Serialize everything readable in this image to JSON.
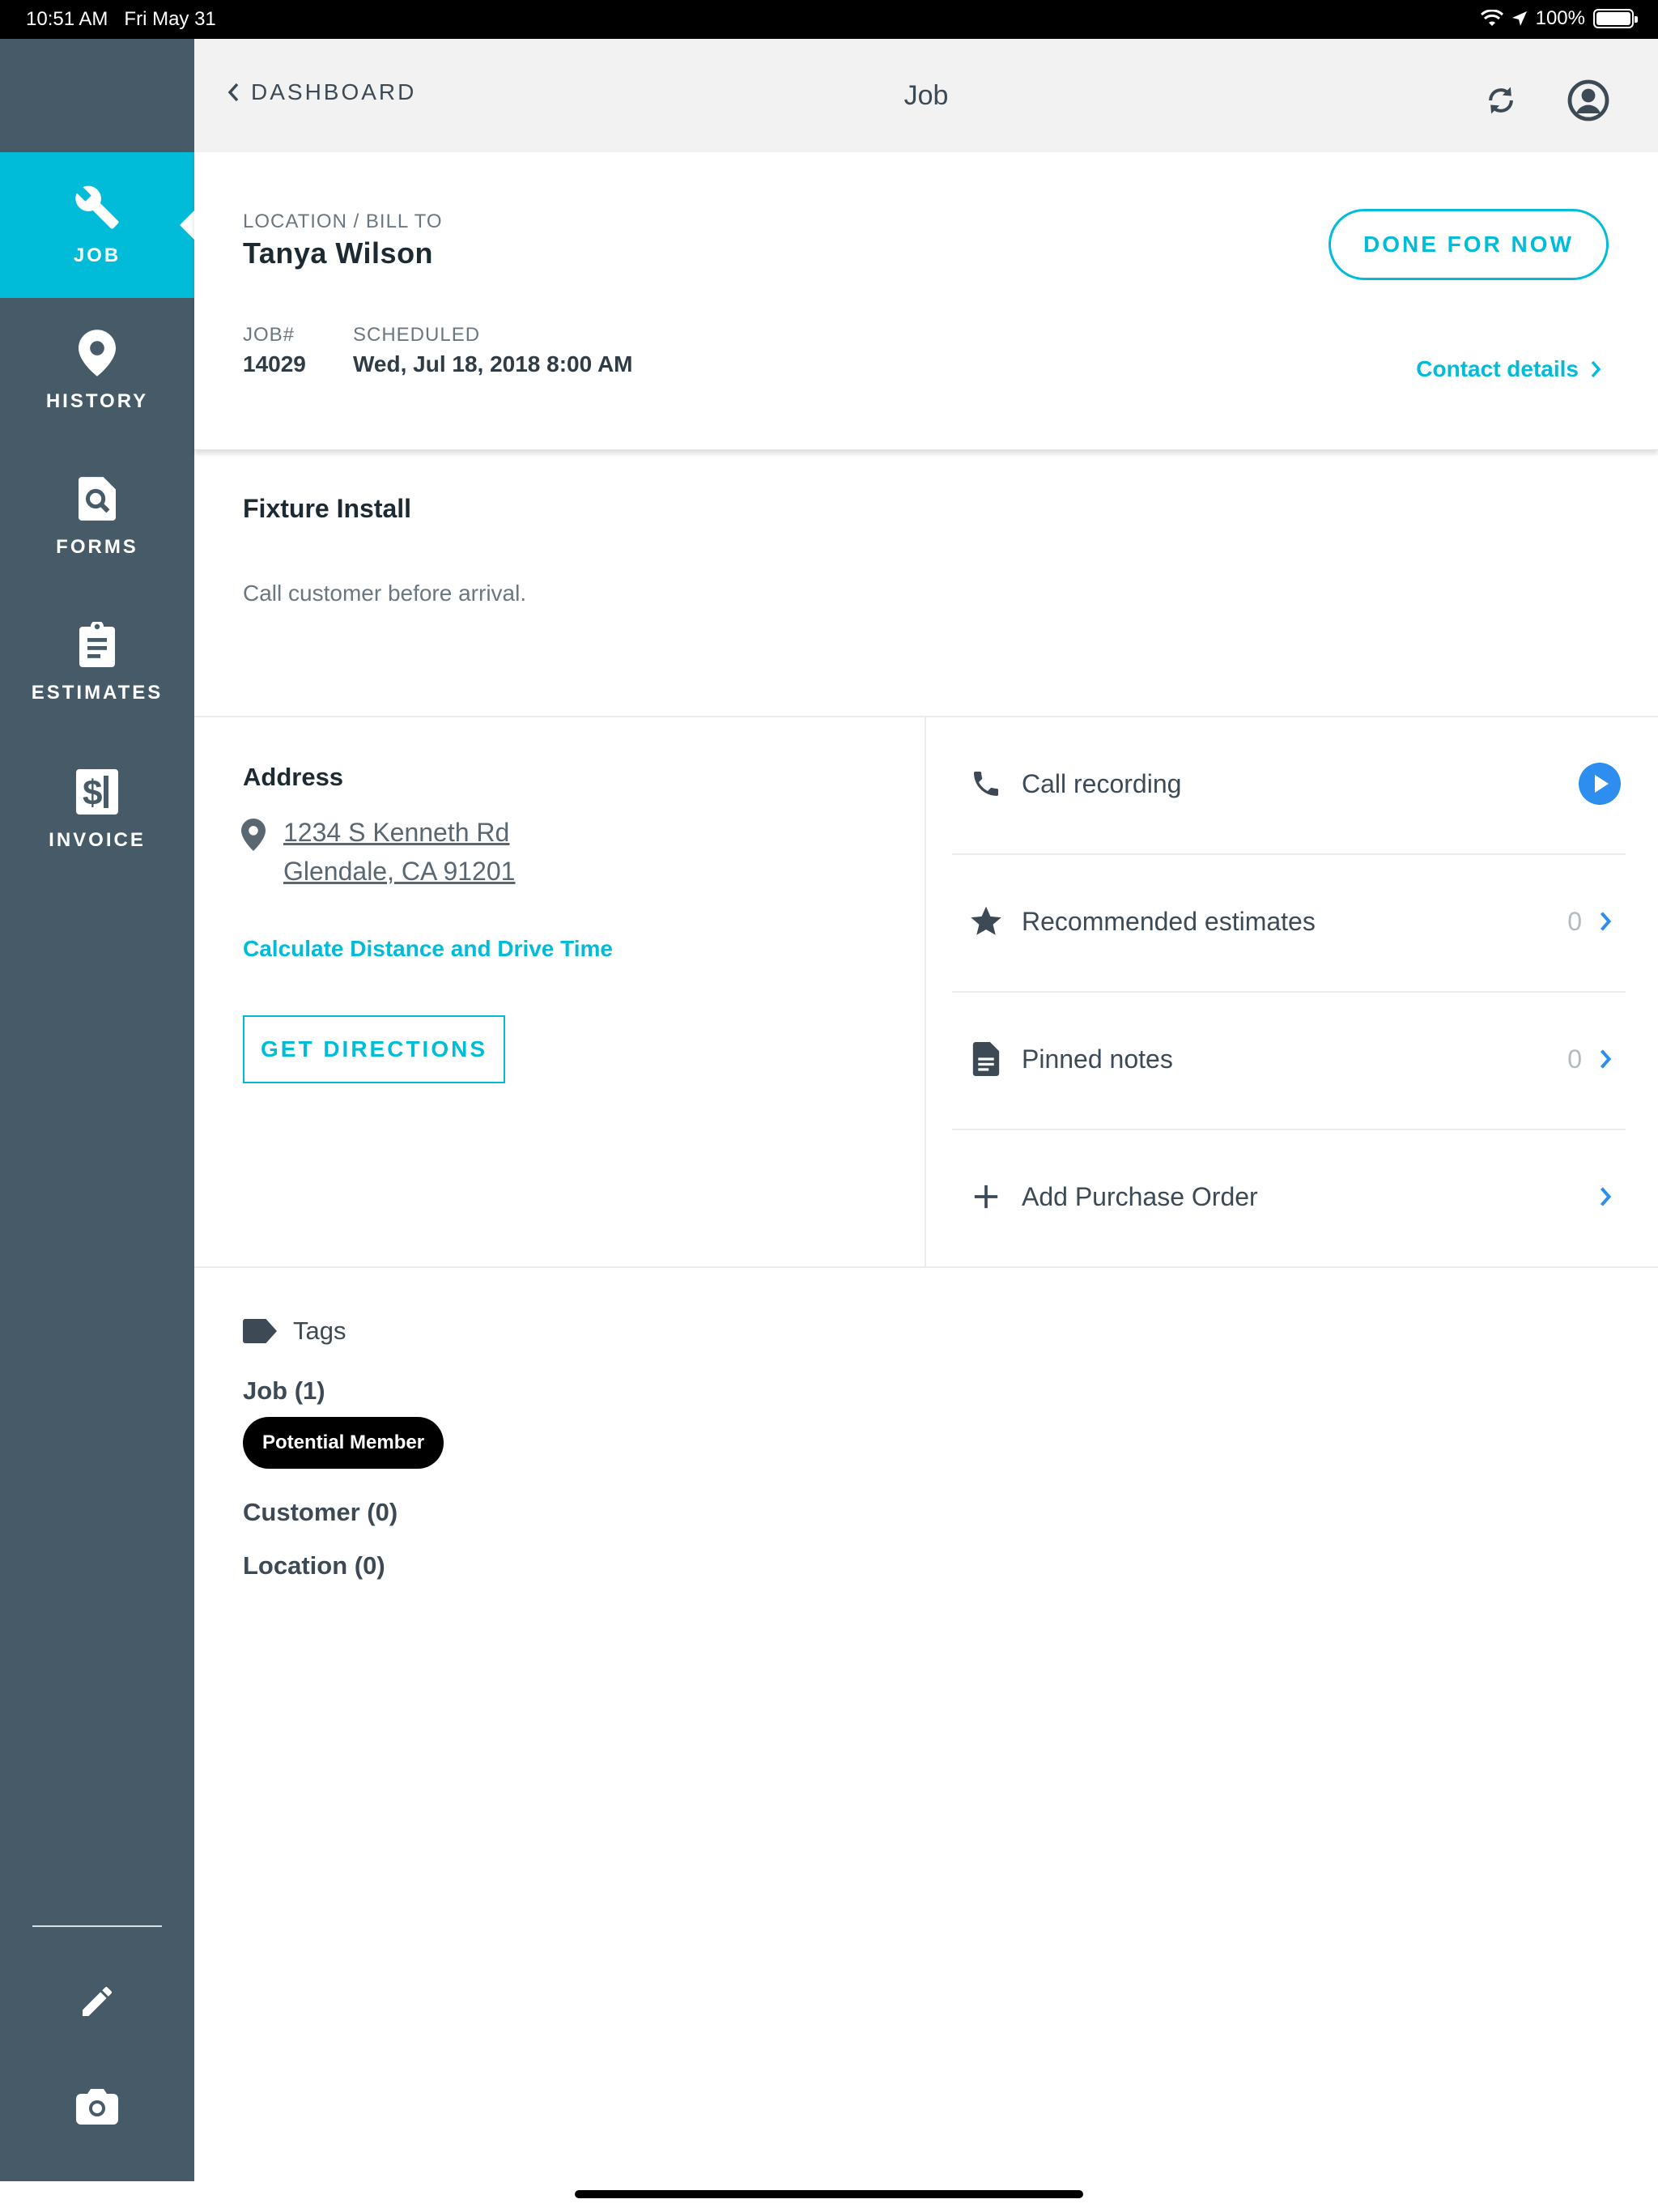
{
  "status_bar": {
    "time": "10:51 AM",
    "date": "Fri May 31",
    "battery": "100%"
  },
  "sidebar": {
    "items": [
      {
        "label": "JOB",
        "icon": "wrench-icon",
        "active": true
      },
      {
        "label": "HISTORY",
        "icon": "location-pin-icon",
        "active": false
      },
      {
        "label": "FORMS",
        "icon": "form-search-icon",
        "active": false
      },
      {
        "label": "ESTIMATES",
        "icon": "clipboard-icon",
        "active": false
      },
      {
        "label": "INVOICE",
        "icon": "invoice-dollar-icon",
        "active": false
      }
    ],
    "tools": [
      {
        "icon": "pencil-icon"
      },
      {
        "icon": "camera-icon"
      }
    ]
  },
  "header": {
    "back_label": "DASHBOARD",
    "title": "Job"
  },
  "job": {
    "location_label": "LOCATION / BILL TO",
    "customer_name": "Tanya Wilson",
    "done_label": "DONE FOR NOW",
    "job_number_label": "JOB#",
    "job_number": "14029",
    "scheduled_label": "SCHEDULED",
    "scheduled_value": "Wed, Jul 18, 2018 8:00 AM",
    "contact_label": "Contact details"
  },
  "description": {
    "title": "Fixture Install",
    "note": "Call customer before arrival."
  },
  "address": {
    "title": "Address",
    "line1": "1234 S Kenneth Rd",
    "line2": "Glendale, CA 91201",
    "calc_label": "Calculate Distance and Drive Time",
    "directions_label": "GET DIRECTIONS"
  },
  "actions": [
    {
      "label": "Call recording",
      "icon": "phone-icon",
      "count": ""
    },
    {
      "label": "Recommended estimates",
      "icon": "star-icon",
      "count": "0"
    },
    {
      "label": "Pinned notes",
      "icon": "document-icon",
      "count": "0"
    },
    {
      "label": "Add Purchase Order",
      "icon": "plus-icon",
      "count": ""
    }
  ],
  "tags": {
    "title": "Tags",
    "job_group": "Job (1)",
    "job_tags": [
      "Potential Member"
    ],
    "customer_group": "Customer (0)",
    "location_group": "Location (0)"
  },
  "colors": {
    "accent": "#00bcd9",
    "sidebar": "#465b67",
    "play": "#2d8ef0"
  }
}
